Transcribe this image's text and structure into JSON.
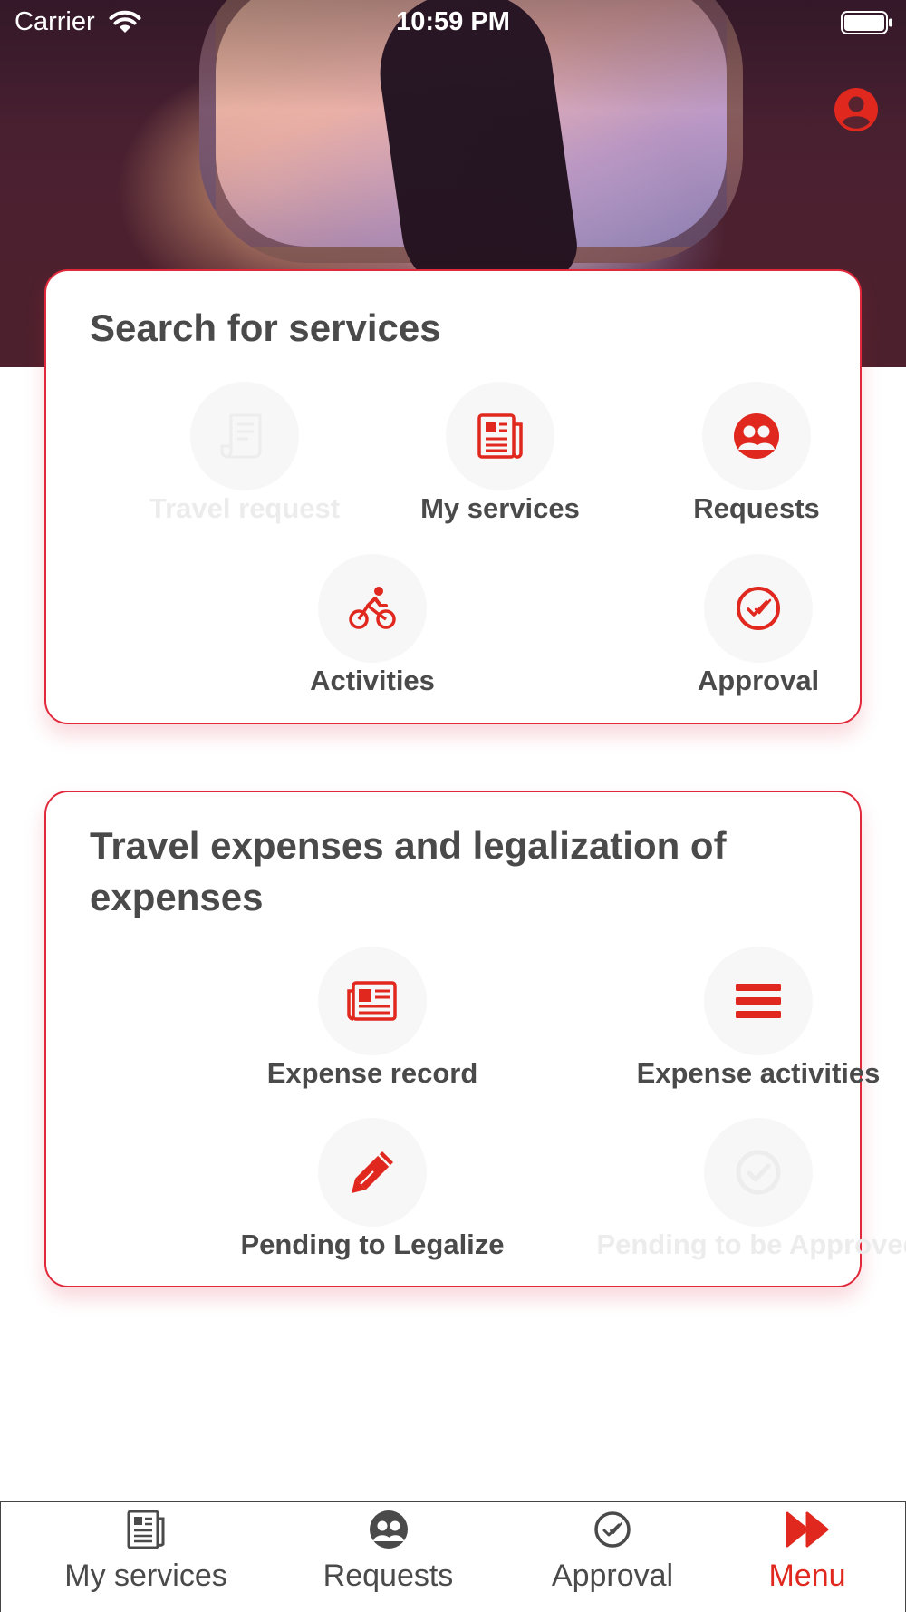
{
  "status_bar": {
    "carrier": "Carrier",
    "time": "10:59 PM"
  },
  "colors": {
    "accent": "#e0281f",
    "card_border": "#e0293b",
    "text": "#4a4a4a",
    "disabled_text": "#ececec",
    "icon_background": "#f7f7f7"
  },
  "header": {
    "profile_icon": "user-circle-icon"
  },
  "services_card": {
    "title": "Search for services",
    "items": [
      {
        "label": "Travel request",
        "icon": "receipt-icon",
        "enabled": false
      },
      {
        "label": "My services",
        "icon": "newspaper-icon",
        "enabled": true
      },
      {
        "label": "Requests",
        "icon": "users-icon",
        "enabled": true
      },
      {
        "label": "Activities",
        "icon": "cyclist-icon",
        "enabled": true
      },
      {
        "label": "Approval",
        "icon": "check-circle-icon",
        "enabled": true
      }
    ]
  },
  "expenses_card": {
    "title": "Travel expenses and legalization of expenses",
    "items": [
      {
        "label": "Expense record",
        "icon": "newspaper-wide-icon",
        "enabled": true
      },
      {
        "label": "Expense activities",
        "icon": "list-bars-icon",
        "enabled": true
      },
      {
        "label": "Pending to Legalize",
        "icon": "pencil-icon",
        "enabled": true
      },
      {
        "label": "Pending to be Approved",
        "icon": "check-circle-icon",
        "enabled": false
      }
    ]
  },
  "tab_bar": {
    "tabs": [
      {
        "label": "My services",
        "icon": "newspaper-icon",
        "active": false
      },
      {
        "label": "Requests",
        "icon": "users-icon",
        "active": false
      },
      {
        "label": "Approval",
        "icon": "check-circle-icon",
        "active": false
      },
      {
        "label": "Menu",
        "icon": "fast-forward-icon",
        "active": true
      }
    ]
  }
}
